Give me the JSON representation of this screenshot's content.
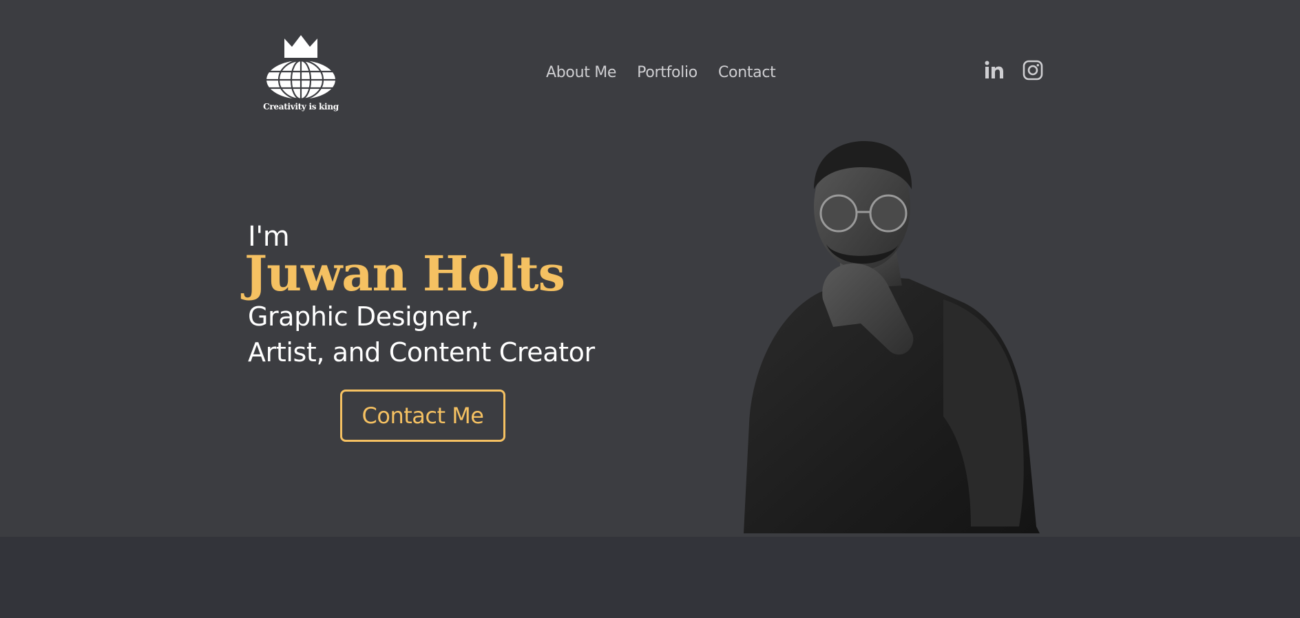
{
  "logo": {
    "tagline": "Creativity is king"
  },
  "nav": {
    "items": [
      {
        "label": "About Me"
      },
      {
        "label": "Portfolio"
      },
      {
        "label": "Contact"
      }
    ]
  },
  "social": {
    "icons": [
      "linkedin-icon",
      "instagram-icon"
    ]
  },
  "hero": {
    "intro": "I'm",
    "name": "Juwan Holts",
    "role_line_1": "Graphic Designer,",
    "role_line_2": "Artist, and Content Creator",
    "cta_label": "Contact Me"
  },
  "colors": {
    "background": "#3c3d41",
    "lower_section": "#33343a",
    "accent": "#f5c162",
    "text": "#ffffff",
    "nav_text": "#cfcfd2"
  }
}
